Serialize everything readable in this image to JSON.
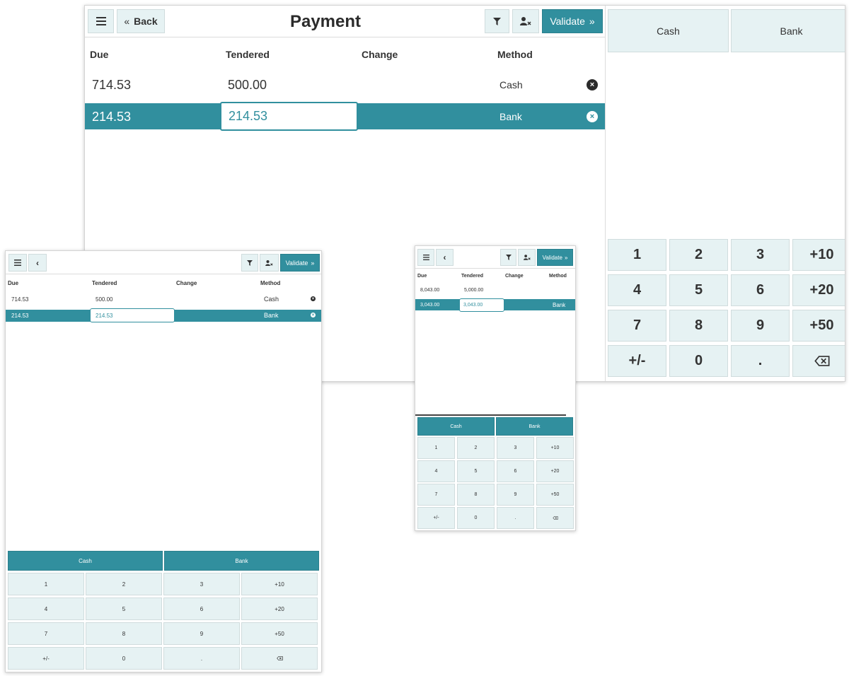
{
  "payment": {
    "title": "Payment",
    "back_label": "Back",
    "validate_label": "Validate",
    "headers": {
      "due": "Due",
      "tendered": "Tendered",
      "change": "Change",
      "method": "Method"
    },
    "methods": [
      "Cash",
      "Bank"
    ],
    "keypad": [
      "1",
      "2",
      "3",
      "+10",
      "4",
      "5",
      "6",
      "+20",
      "7",
      "8",
      "9",
      "+50",
      "+/-",
      "0",
      "."
    ]
  },
  "large": {
    "lines": [
      {
        "due": "714.53",
        "tendered": "500.00",
        "method": "Cash"
      },
      {
        "due": "214.53",
        "tendered": "214.53",
        "method": "Bank"
      }
    ]
  },
  "tablet": {
    "lines": [
      {
        "due": "714.53",
        "tendered": "500.00",
        "method": "Cash"
      },
      {
        "due": "214.53",
        "tendered": "214.53",
        "method": "Bank"
      }
    ]
  },
  "phone": {
    "lines": [
      {
        "due": "8,043.00",
        "tendered": "5,000.00",
        "method": ""
      },
      {
        "due": "3,043.00",
        "tendered": "3,043.00",
        "method": "Bank"
      }
    ]
  },
  "icons": [
    "menu-icon",
    "chevron-left-icon",
    "double-chevron-left-icon",
    "filter-icon",
    "user-remove-icon",
    "double-chevron-right-icon",
    "remove-line-icon",
    "backspace-icon"
  ],
  "colors": {
    "accent": "#318f9e",
    "button_bg": "#e6f2f3"
  }
}
